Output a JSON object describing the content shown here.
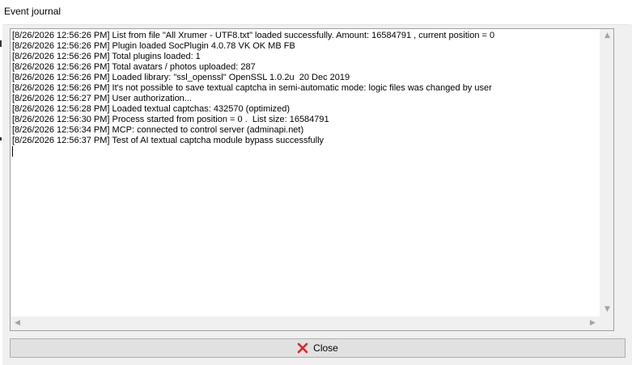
{
  "window": {
    "title": "Event journal"
  },
  "log": {
    "lines": [
      "[8/26/2026 12:56:26 PM] List from file \"All Xrumer - UTF8.txt\" loaded successfully. Amount: 16584791 , current position = 0",
      "[8/26/2026 12:56:26 PM] Plugin loaded SocPlugin 4.0.78 VK OK MB FB",
      "[8/26/2026 12:56:26 PM] Total plugins loaded: 1",
      "[8/26/2026 12:56:26 PM] Total avatars / photos uploaded: 287",
      "[8/26/2026 12:56:26 PM] Loaded library: \"ssl_openssl\" OpenSSL 1.0.2u  20 Dec 2019",
      "[8/26/2026 12:56:26 PM] It's not possible to save textual captcha in semi-automatic mode: logic files was changed by user",
      "[8/26/2026 12:56:27 PM] User authorization...",
      "[8/26/2026 12:56:28 PM] Loaded textual captchas: 432570 (optimized)",
      "[8/26/2026 12:56:30 PM] Process started from position = 0 .  List size: 16584791",
      "[8/26/2026 12:56:34 PM] MCP: connected to control server (adminapi.net)",
      "[8/26/2026 12:56:37 PM] Test of AI textual captcha module bypass successfully"
    ]
  },
  "buttons": {
    "close_label": "Close"
  },
  "icons": {
    "close": "close-x-icon",
    "scroll_up": "arrow-up-icon",
    "scroll_down": "arrow-down-icon",
    "scroll_left": "arrow-left-icon",
    "scroll_right": "arrow-right-icon"
  },
  "colors": {
    "close_icon": "#d9262b",
    "button_face": "#e1e1e1",
    "window_face": "#f0f0f0"
  }
}
